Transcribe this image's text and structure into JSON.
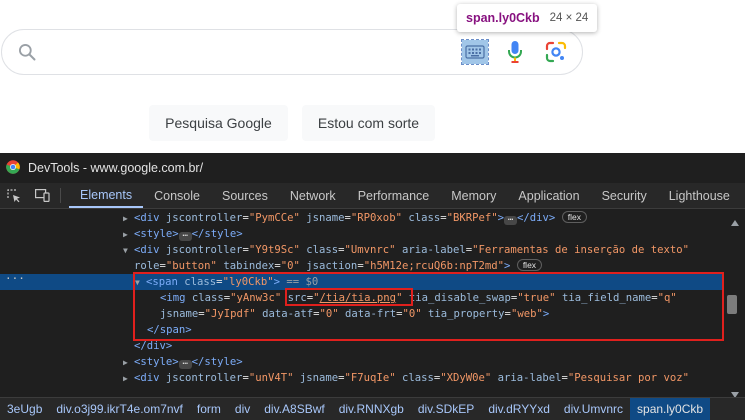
{
  "google": {
    "buttons": {
      "search": "Pesquisa Google",
      "lucky": "Estou com sorte"
    }
  },
  "tooltip": {
    "tag": "span.ly0Ckb",
    "dims": "24 × 24"
  },
  "devtools": {
    "title": "DevTools - www.google.com.br/",
    "tabs": [
      "Elements",
      "Console",
      "Sources",
      "Network",
      "Performance",
      "Memory",
      "Application",
      "Security",
      "Lighthouse"
    ],
    "active_tab": "Elements",
    "dom": {
      "l1": {
        "tag_open": "<div ",
        "a1": "jscontroller",
        "v1": "\"PymCCe\"",
        "a2": "jsname",
        "v2": "\"RP0xob\"",
        "a3": "class",
        "v3": "\"BKRPef\"",
        "close": "</div>",
        "badge": "flex"
      },
      "l2": {
        "open": "<style>",
        "close": "</style>"
      },
      "l3": {
        "tag_open": "<div ",
        "a1": "jscontroller",
        "v1": "\"Y9t9Sc\"",
        "a2": "class",
        "v2": "\"Umvnrc\"",
        "a3": "aria-label",
        "v3": "\"Ferramentas de inserção de texto\""
      },
      "l4": {
        "a1": "role",
        "v1": "\"button\"",
        "a2": "tabindex",
        "v2": "\"0\"",
        "a3": "jsaction",
        "v3": "\"h5M12e;rcuQ6b:npT2md\"",
        "end": ">",
        "badge": "flex"
      },
      "l5": {
        "tag_open": "<span ",
        "a1": "class",
        "v1": "\"ly0Ckb\"",
        "end": ">",
        "eq": " == $0"
      },
      "l6": {
        "tag_open": "<img ",
        "a1": "class",
        "v1": "\"yAnw3c\"",
        "a2": "src",
        "v2q1": "\"",
        "v2": "/tia/tia.png",
        "v2q2": "\"",
        "a3": "tia_disable_swap",
        "v3": "\"true\"",
        "a4": "tia_field_name",
        "v4": "\"q\""
      },
      "l7": {
        "a1": "jsname",
        "v1": "\"JyIpdf\"",
        "a2": "data-atf",
        "v2": "\"0\"",
        "a3": "data-frt",
        "v3": "\"0\"",
        "a4": "tia_property",
        "v4": "\"web\"",
        "end": ">"
      },
      "l8": {
        "close": "</span>"
      },
      "l9": {
        "close": "</div>"
      },
      "l10": {
        "open": "<style>",
        "close": "</style>"
      },
      "l11": {
        "tag_open": "<div ",
        "a1": "jscontroller",
        "v1": "\"unV4T\"",
        "a2": "jsname",
        "v2": "\"F7uqIe\"",
        "a3": "class",
        "v3": "\"XDyW0e\"",
        "a4": "aria-label",
        "v4": "\"Pesquisar por voz\""
      }
    },
    "breadcrumbs": [
      "3eUgb",
      "div.o3j99.ikrT4e.om7nvf",
      "form",
      "div",
      "div.A8SBwf",
      "div.RNNXgb",
      "div.SDkEP",
      "div.dRYYxd",
      "div.Umvnrc",
      "span.ly0Ckb"
    ],
    "active_breadcrumb": "span.ly0Ckb",
    "gutter_dots": "···"
  },
  "colors": {
    "selection": "#0f4a85",
    "highlight_box": "#e0201d",
    "devtools_bg": "#1f1f1f",
    "accent": "#a8c7fa"
  }
}
